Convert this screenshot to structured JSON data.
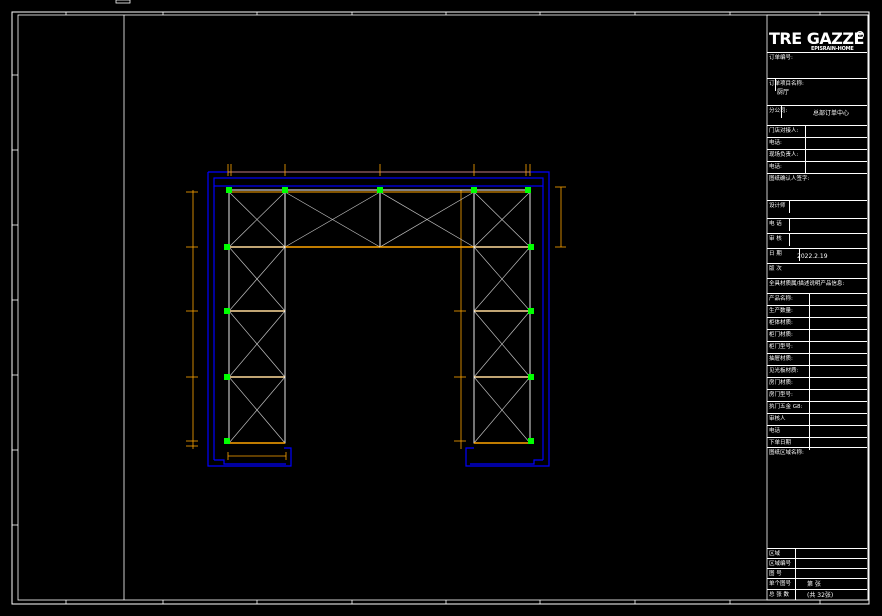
{
  "title_block": {
    "logo_text": "TRE GAZZE",
    "logo_sub": "EPISRAIN-HOME",
    "logo_mark": "R",
    "rows": [
      {
        "label": "订单编号:",
        "value": ""
      },
      {
        "label": "订单项目名称:",
        "value": "厨厅"
      },
      {
        "label": "分公司:",
        "value": "总部订单中心"
      },
      {
        "label": "门店对接人:",
        "value": ""
      },
      {
        "label": "电话:",
        "value": ""
      },
      {
        "label": "现场负责人:",
        "value": ""
      },
      {
        "label": "电话:",
        "value": ""
      },
      {
        "label": "图纸确认人签字:",
        "value": ""
      },
      {
        "label": "设计师",
        "value": ""
      },
      {
        "label": "电 话",
        "value": ""
      },
      {
        "label": "审 核",
        "value": ""
      },
      {
        "label": "日 期",
        "value": "2022.2.19"
      },
      {
        "label": "版 次",
        "value": ""
      },
      {
        "label": "全具材质属/描述说明产品信息:",
        "value": ""
      },
      {
        "label": "产品名称:",
        "value": ""
      },
      {
        "label": "生产数量:",
        "value": ""
      },
      {
        "label": "柜体材质:",
        "value": ""
      },
      {
        "label": "柜门材质:",
        "value": ""
      },
      {
        "label": "柜门型号:",
        "value": ""
      },
      {
        "label": "抽屉材质:",
        "value": ""
      },
      {
        "label": "见光板材质:",
        "value": ""
      },
      {
        "label": "房门材质:",
        "value": ""
      },
      {
        "label": "房门型号:",
        "value": ""
      },
      {
        "label": "执门五金 G8:",
        "value": ""
      },
      {
        "label": "审核人",
        "value": ""
      },
      {
        "label": "电话",
        "value": ""
      },
      {
        "label": "下单日期",
        "value": ""
      },
      {
        "label": "图纸区域名称:",
        "value": ""
      }
    ],
    "footer_rows": [
      {
        "label": "区域",
        "value": ""
      },
      {
        "label": "区域编号",
        "value": ""
      },
      {
        "label": "图 号",
        "value": ""
      },
      {
        "label": "单个图号",
        "value": "第 张"
      },
      {
        "label": "总 张 数",
        "value": "(共 32张)"
      }
    ]
  },
  "colors": {
    "frame": "#ffffff",
    "outline": "#0000ff",
    "cabinet": "#ffa500",
    "dimension": "#ffa500",
    "connector": "#00ff00",
    "brace": "#c0c0c0"
  }
}
